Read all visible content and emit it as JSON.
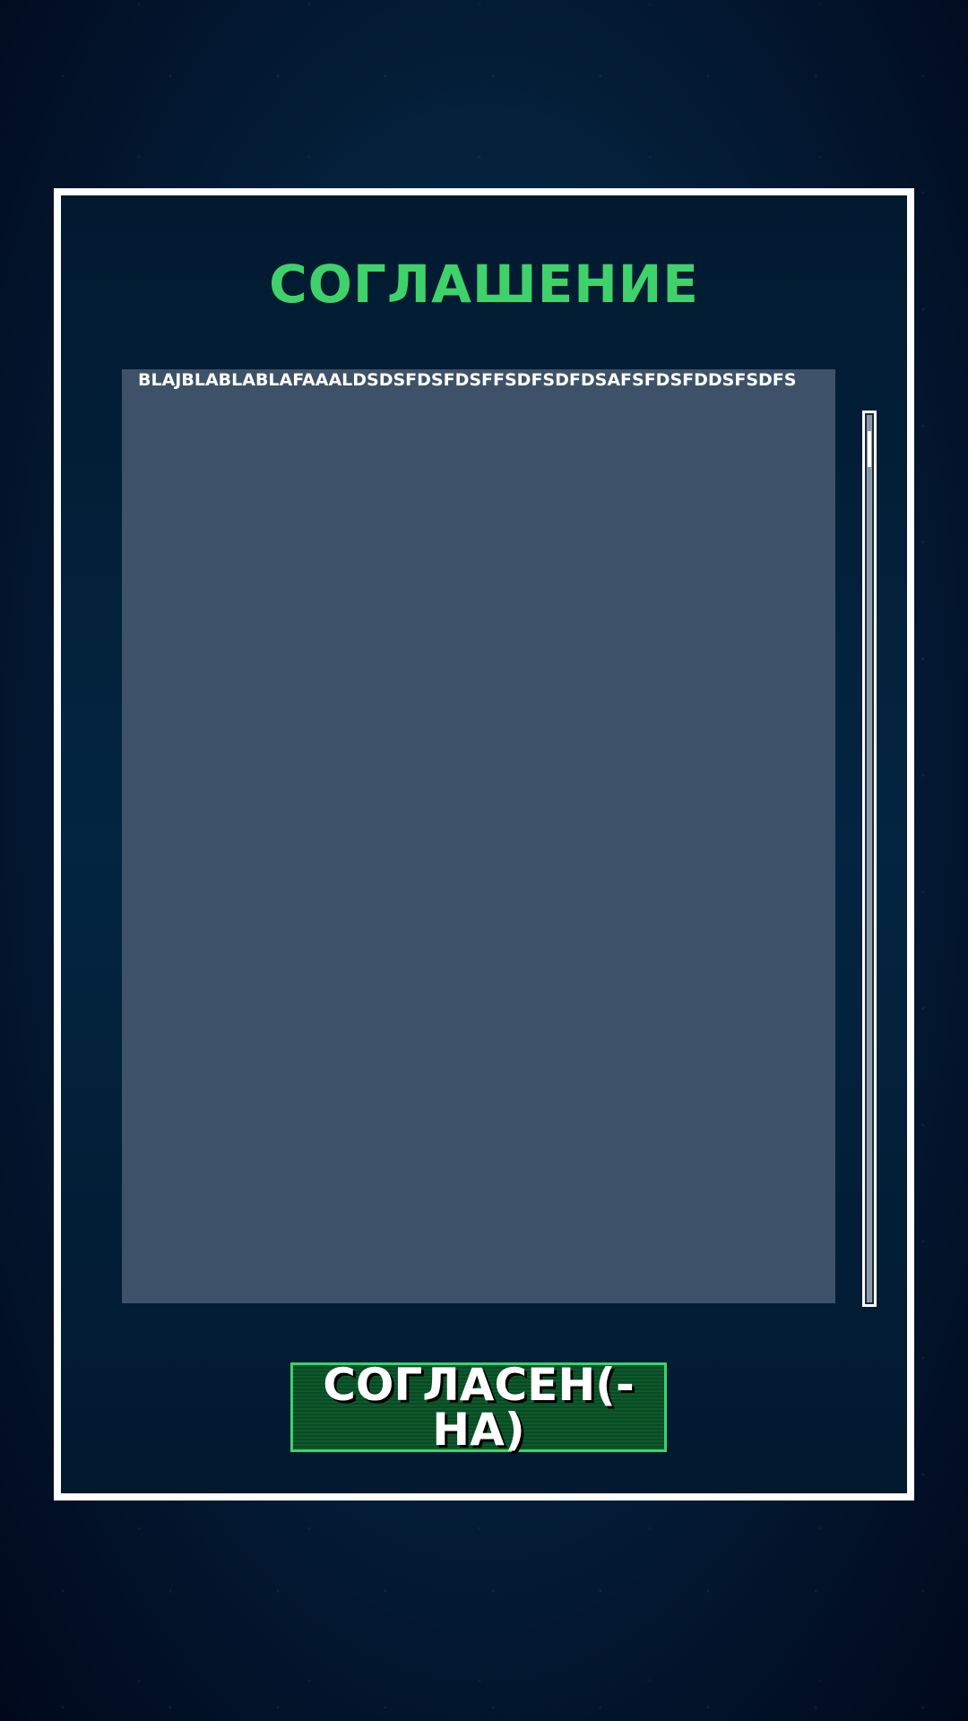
{
  "dialog": {
    "title": "СОГЛАШЕНИЕ",
    "body_text": "BLAJBLABLABLAFAAALDSDSFDSFDSFFSDFSDFDSAFSFDSFDDSFSDFS",
    "agree_button_label": "СОГЛАСЕН(-НА)"
  },
  "scrollbar": {
    "position_fraction": 0.0
  },
  "colors": {
    "accent_green": "#3fd26a",
    "panel_background": "#3d5268",
    "frame": "#ffffff",
    "button_fill": "#0d5a2c"
  }
}
